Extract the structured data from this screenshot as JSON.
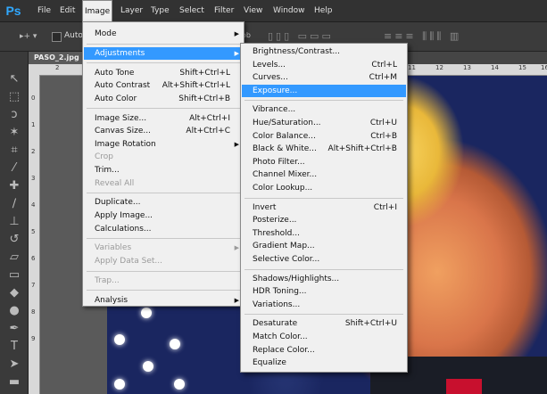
{
  "app": {
    "logo": "Ps"
  },
  "menubar": {
    "items": [
      "File",
      "Edit",
      "Image",
      "Layer",
      "Type",
      "Select",
      "Filter",
      "View",
      "Window",
      "Help"
    ],
    "active": "Image"
  },
  "options": {
    "move_glyph": "▸+ ▾",
    "auto_label": "Auto-",
    "ob": "ob"
  },
  "document": {
    "tab": "PASO_2.jpg"
  },
  "ruler": {
    "h_ticks": [
      "2",
      "11",
      "12",
      "13",
      "14",
      "15",
      "16"
    ],
    "v_ticks": [
      "0",
      "1",
      "2",
      "3",
      "4",
      "5",
      "6",
      "7",
      "8",
      "9"
    ]
  },
  "image_menu": [
    {
      "label": "Mode",
      "submenu": true
    },
    {
      "sep": true
    },
    {
      "label": "Adjustments",
      "submenu": true,
      "highlight": true
    },
    {
      "sep": true
    },
    {
      "label": "Auto Tone",
      "shortcut": "Shift+Ctrl+L"
    },
    {
      "label": "Auto Contrast",
      "shortcut": "Alt+Shift+Ctrl+L"
    },
    {
      "label": "Auto Color",
      "shortcut": "Shift+Ctrl+B"
    },
    {
      "sep": true
    },
    {
      "label": "Image Size...",
      "shortcut": "Alt+Ctrl+I"
    },
    {
      "label": "Canvas Size...",
      "shortcut": "Alt+Ctrl+C"
    },
    {
      "label": "Image Rotation",
      "submenu": true
    },
    {
      "label": "Crop",
      "disabled": true
    },
    {
      "label": "Trim..."
    },
    {
      "label": "Reveal All",
      "disabled": true
    },
    {
      "sep": true
    },
    {
      "label": "Duplicate..."
    },
    {
      "label": "Apply Image..."
    },
    {
      "label": "Calculations..."
    },
    {
      "sep": true
    },
    {
      "label": "Variables",
      "submenu": true,
      "disabled": true
    },
    {
      "label": "Apply Data Set...",
      "disabled": true
    },
    {
      "sep": true
    },
    {
      "label": "Trap...",
      "disabled": true
    },
    {
      "sep": true
    },
    {
      "label": "Analysis",
      "submenu": true
    }
  ],
  "adjustments_menu": [
    {
      "label": "Brightness/Contrast..."
    },
    {
      "label": "Levels...",
      "shortcut": "Ctrl+L"
    },
    {
      "label": "Curves...",
      "shortcut": "Ctrl+M"
    },
    {
      "label": "Exposure...",
      "highlight": true
    },
    {
      "sep": true
    },
    {
      "label": "Vibrance..."
    },
    {
      "label": "Hue/Saturation...",
      "shortcut": "Ctrl+U"
    },
    {
      "label": "Color Balance...",
      "shortcut": "Ctrl+B"
    },
    {
      "label": "Black & White...",
      "shortcut": "Alt+Shift+Ctrl+B"
    },
    {
      "label": "Photo Filter..."
    },
    {
      "label": "Channel Mixer..."
    },
    {
      "label": "Color Lookup..."
    },
    {
      "sep": true
    },
    {
      "label": "Invert",
      "shortcut": "Ctrl+I"
    },
    {
      "label": "Posterize..."
    },
    {
      "label": "Threshold..."
    },
    {
      "label": "Gradient Map..."
    },
    {
      "label": "Selective Color..."
    },
    {
      "sep": true
    },
    {
      "label": "Shadows/Highlights..."
    },
    {
      "label": "HDR Toning..."
    },
    {
      "label": "Variations..."
    },
    {
      "sep": true
    },
    {
      "label": "Desaturate",
      "shortcut": "Shift+Ctrl+U"
    },
    {
      "label": "Match Color..."
    },
    {
      "label": "Replace Color..."
    },
    {
      "label": "Equalize"
    }
  ],
  "tools": [
    "move-icon",
    "marquee-icon",
    "lasso-icon",
    "magic-wand-icon",
    "crop-icon",
    "eyedropper-icon",
    "healing-brush-icon",
    "brush-icon",
    "clone-stamp-icon",
    "history-brush-icon",
    "eraser-icon",
    "gradient-icon",
    "blur-icon",
    "dodge-icon",
    "pen-icon",
    "type-icon",
    "path-selection-icon",
    "rectangle-icon"
  ]
}
